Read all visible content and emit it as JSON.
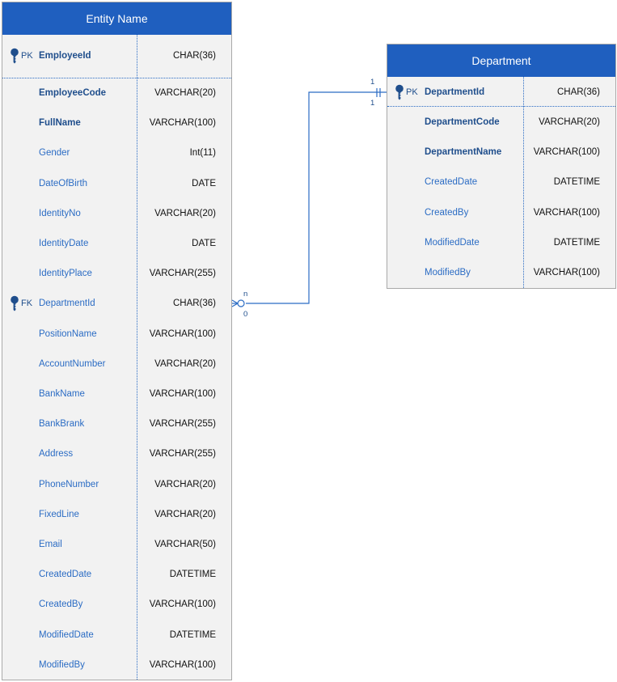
{
  "employee": {
    "title": "Entity Name",
    "pk": {
      "marker": "PK",
      "name": "EmployeeId",
      "type": "CHAR(36)"
    },
    "fields": [
      {
        "name": "EmployeeCode",
        "type": "VARCHAR(20)",
        "bold": true
      },
      {
        "name": "FullName",
        "type": "VARCHAR(100)",
        "bold": true
      },
      {
        "name": "Gender",
        "type": "Int(11)"
      },
      {
        "name": "DateOfBirth",
        "type": "DATE"
      },
      {
        "name": "IdentityNo",
        "type": "VARCHAR(20)"
      },
      {
        "name": "IdentityDate",
        "type": "DATE"
      },
      {
        "name": "IdentityPlace",
        "type": "VARCHAR(255)"
      },
      {
        "name": "DepartmentId",
        "type": "CHAR(36)",
        "key": "FK"
      },
      {
        "name": "PositionName",
        "type": "VARCHAR(100)"
      },
      {
        "name": "AccountNumber",
        "type": "VARCHAR(20)"
      },
      {
        "name": "BankName",
        "type": "VARCHAR(100)"
      },
      {
        "name": "BankBrank",
        "type": "VARCHAR(255)"
      },
      {
        "name": "Address",
        "type": "VARCHAR(255)"
      },
      {
        "name": "PhoneNumber",
        "type": "VARCHAR(20)"
      },
      {
        "name": "FixedLine",
        "type": "VARCHAR(20)"
      },
      {
        "name": "Email",
        "type": "VARCHAR(50)"
      },
      {
        "name": "CreatedDate",
        "type": "DATETIME"
      },
      {
        "name": "CreatedBy",
        "type": "VARCHAR(100)"
      },
      {
        "name": "ModifiedDate",
        "type": "DATETIME"
      },
      {
        "name": "ModifiedBy",
        "type": "VARCHAR(100)"
      }
    ]
  },
  "department": {
    "title": "Department",
    "pk": {
      "marker": "PK",
      "name": "DepartmentId",
      "type": "CHAR(36)"
    },
    "fields": [
      {
        "name": "DepartmentCode",
        "type": "VARCHAR(20)",
        "bold": true
      },
      {
        "name": "DepartmentName",
        "type": "VARCHAR(100)",
        "bold": true
      },
      {
        "name": "CreatedDate",
        "type": "DATETIME"
      },
      {
        "name": "CreatedBy",
        "type": "VARCHAR(100)"
      },
      {
        "name": "ModifiedDate",
        "type": "DATETIME"
      },
      {
        "name": "ModifiedBy",
        "type": "VARCHAR(100)"
      }
    ]
  },
  "relationship": {
    "one_side_top": "1",
    "one_side_bottom": "1",
    "many_side_top": "n",
    "many_side_bottom": "0"
  },
  "colors": {
    "header": "#1f5fbf",
    "body": "#f2f2f2",
    "text": "#2b6cc4",
    "line": "#2b6cc4"
  },
  "icons": {
    "key": "key-icon"
  }
}
